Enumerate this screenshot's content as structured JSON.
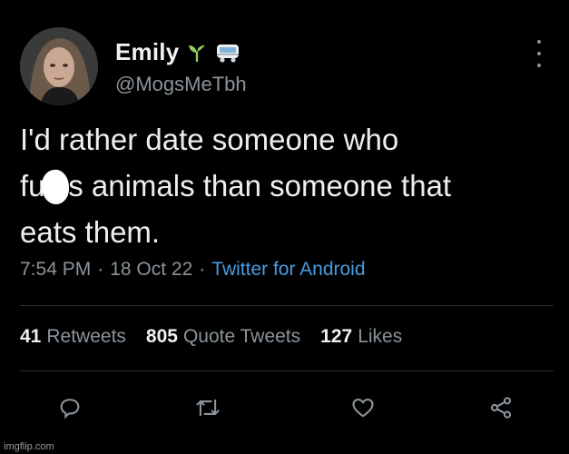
{
  "user": {
    "display_name": "Emily",
    "handle": "@MogsMeTbh",
    "emoji_1": "seedling-icon",
    "emoji_2": "bus-icon"
  },
  "tweet": {
    "text": "I'd rather date someone who\nfu  ks animals than someone that\neats them.",
    "time": "7:54 PM",
    "date": "18 Oct 22",
    "separator": "·",
    "source": "Twitter for Android"
  },
  "stats": {
    "retweets_count": "41",
    "retweets_label": "Retweets",
    "quotes_count": "805",
    "quotes_label": "Quote Tweets",
    "likes_count": "127",
    "likes_label": "Likes"
  },
  "actions": [
    "reply-icon",
    "retweet-icon",
    "like-icon",
    "share-icon"
  ],
  "watermark": "imgflip.com",
  "colors": {
    "background": "#000000",
    "text": "#e7e9ea",
    "muted": "#8b949a",
    "link": "#4a9be0",
    "divider": "#2c2f31"
  }
}
